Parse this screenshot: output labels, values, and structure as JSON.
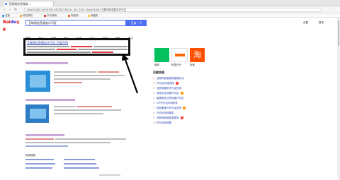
{
  "browser": {
    "tab_title": "互联网信息服务...",
    "url": "www.baidu.com/s?ie=utf-8&f=8&rsv_bp=1&tn=baidu&wd=互联网信息服务许可证",
    "bookmarks": [
      "百度",
      "网站导航",
      "京东商城",
      "淘宝网",
      "收藏夹"
    ]
  },
  "header": {
    "logo_text": "Bai",
    "logo_du": "du",
    "logo_suffix": "百度",
    "search_value": "互联网信息服务许可证",
    "search_button": "百度一下",
    "right_links": [
      "设置",
      "登录"
    ]
  },
  "tabs": [
    "网页",
    "资讯",
    "视频",
    "图片",
    "知道",
    "文库",
    "贴吧",
    "地图",
    "更多"
  ],
  "highlight_result": {
    "title": "互联网信息服务许可证_百度百科"
  },
  "side": {
    "captions": [
      "微信",
      "阿里巴巴",
      "淘宝"
    ],
    "hot_heading": "百度热搜",
    "hot_list": [
      {
        "num": "1",
        "text": "互联网信息服务管理办法"
      },
      {
        "num": "2",
        "text": "许可证办理流程"
      },
      {
        "num": "3",
        "text": "互联网服务许可证查询"
      },
      {
        "num": "4",
        "text": "网络文化经营许可证"
      },
      {
        "num": "5",
        "text": "增值电信业务经营许可证"
      },
      {
        "num": "6",
        "text": "ICP许可证申请条件"
      },
      {
        "num": "7",
        "text": "网站备案与许可证区别"
      },
      {
        "num": "8",
        "text": "许可证年检要求"
      },
      {
        "num": "9",
        "text": "互联网新闻信息服务"
      },
      {
        "num": "10",
        "text": "许可证有效期"
      }
    ]
  },
  "related_title": "相关搜索"
}
